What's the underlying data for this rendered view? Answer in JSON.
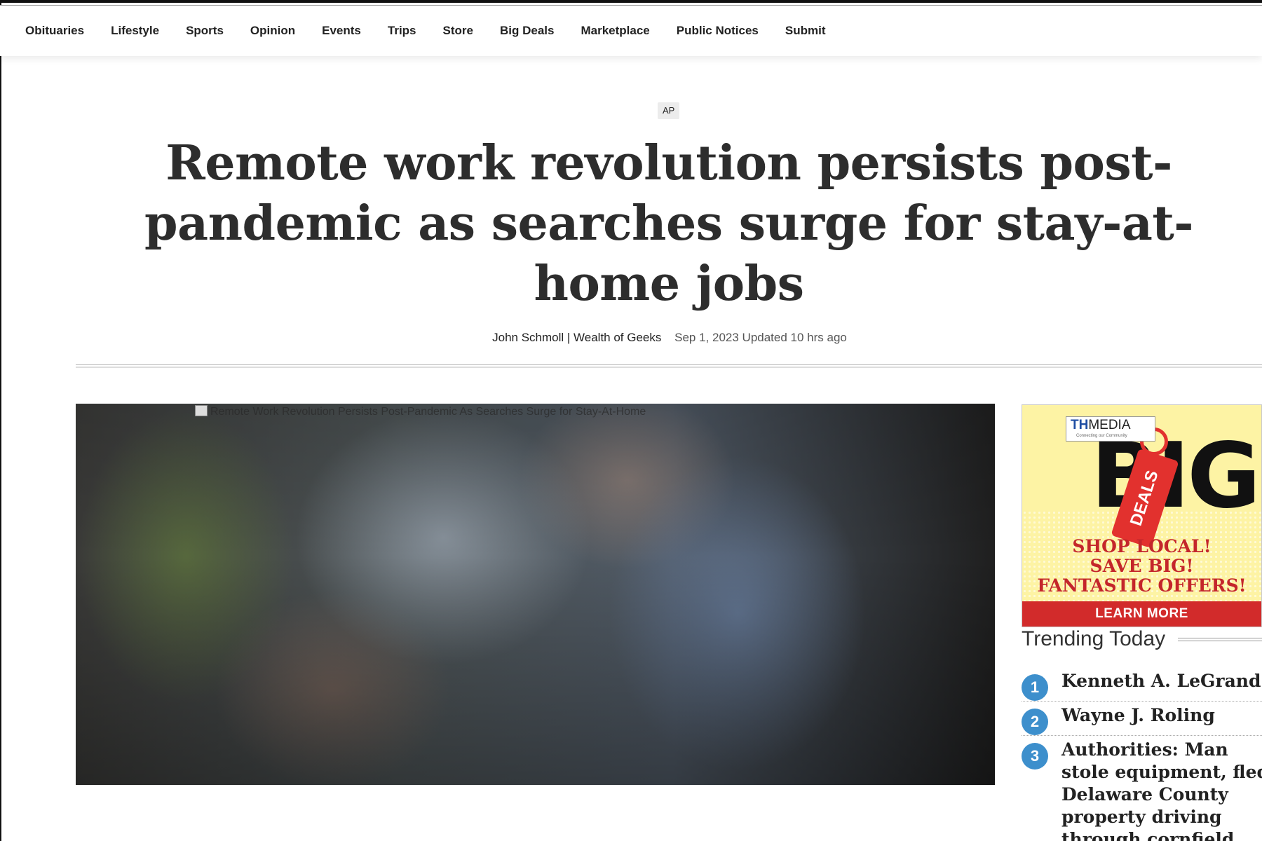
{
  "nav": {
    "items": [
      "Obituaries",
      "Lifestyle",
      "Sports",
      "Opinion",
      "Events",
      "Trips",
      "Store",
      "Big Deals",
      "Marketplace",
      "Public Notices",
      "Submit"
    ]
  },
  "article": {
    "kicker": "AP",
    "headline": "Remote work revolution persists post-pandemic as searches surge for stay-at-home jobs",
    "author": "John Schmoll | Wealth of Geeks",
    "date": "Sep 1, 2023 Updated 10 hrs ago",
    "image_alt": "Remote Work Revolution Persists Post-Pandemic As Searches Surge for Stay-At-Home"
  },
  "ad": {
    "brand_th": "TH",
    "brand_media": "MEDIA",
    "brand_tagline": "Connecting our Community",
    "big_text": "BIG",
    "deals_text": "DEALS",
    "slogan_lines": [
      "SHOP LOCAL!",
      "SAVE BIG!",
      "FANTASTIC OFFERS!"
    ],
    "cta": "LEARN MORE",
    "colors": {
      "background": "#fdf3a4",
      "accent": "#d22b2b"
    }
  },
  "trending": {
    "title": "Trending Today",
    "items": [
      {
        "rank": "1",
        "title": "Kenneth A. LeGrand"
      },
      {
        "rank": "2",
        "title": "Wayne J. Roling"
      },
      {
        "rank": "3",
        "title": "Authorities: Man stole equipment, fled Delaware County property driving through cornfield"
      }
    ],
    "badge_color": "#3d8fcc"
  }
}
